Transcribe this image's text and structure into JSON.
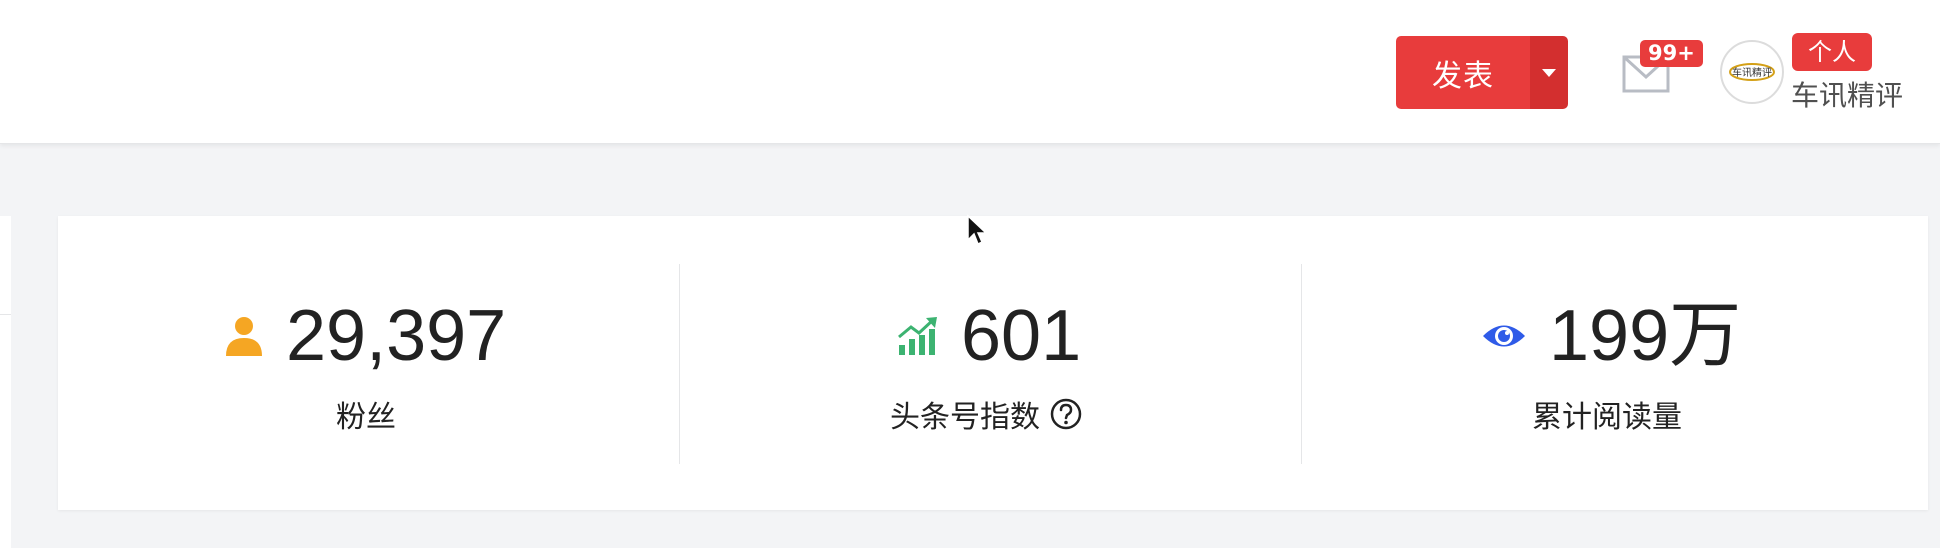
{
  "header": {
    "publish_label": "发表",
    "mail_badge": "99+",
    "account_tag": "个人",
    "account_name": "车讯精评",
    "avatar_text": "车讯精评"
  },
  "stats": [
    {
      "icon": "user-icon",
      "value": "29,397",
      "label": "粉丝",
      "color": "#f5a623"
    },
    {
      "icon": "trend-up-icon",
      "value": "601",
      "label": "头条号指数",
      "color": "#3cb371",
      "has_help": true
    },
    {
      "icon": "eye-icon",
      "value": "199万",
      "label": "累计阅读量",
      "color": "#2f5be8"
    }
  ],
  "colors": {
    "accent": "#e83c3c",
    "accent_dark": "#d32f2f",
    "background": "#f3f4f6"
  }
}
